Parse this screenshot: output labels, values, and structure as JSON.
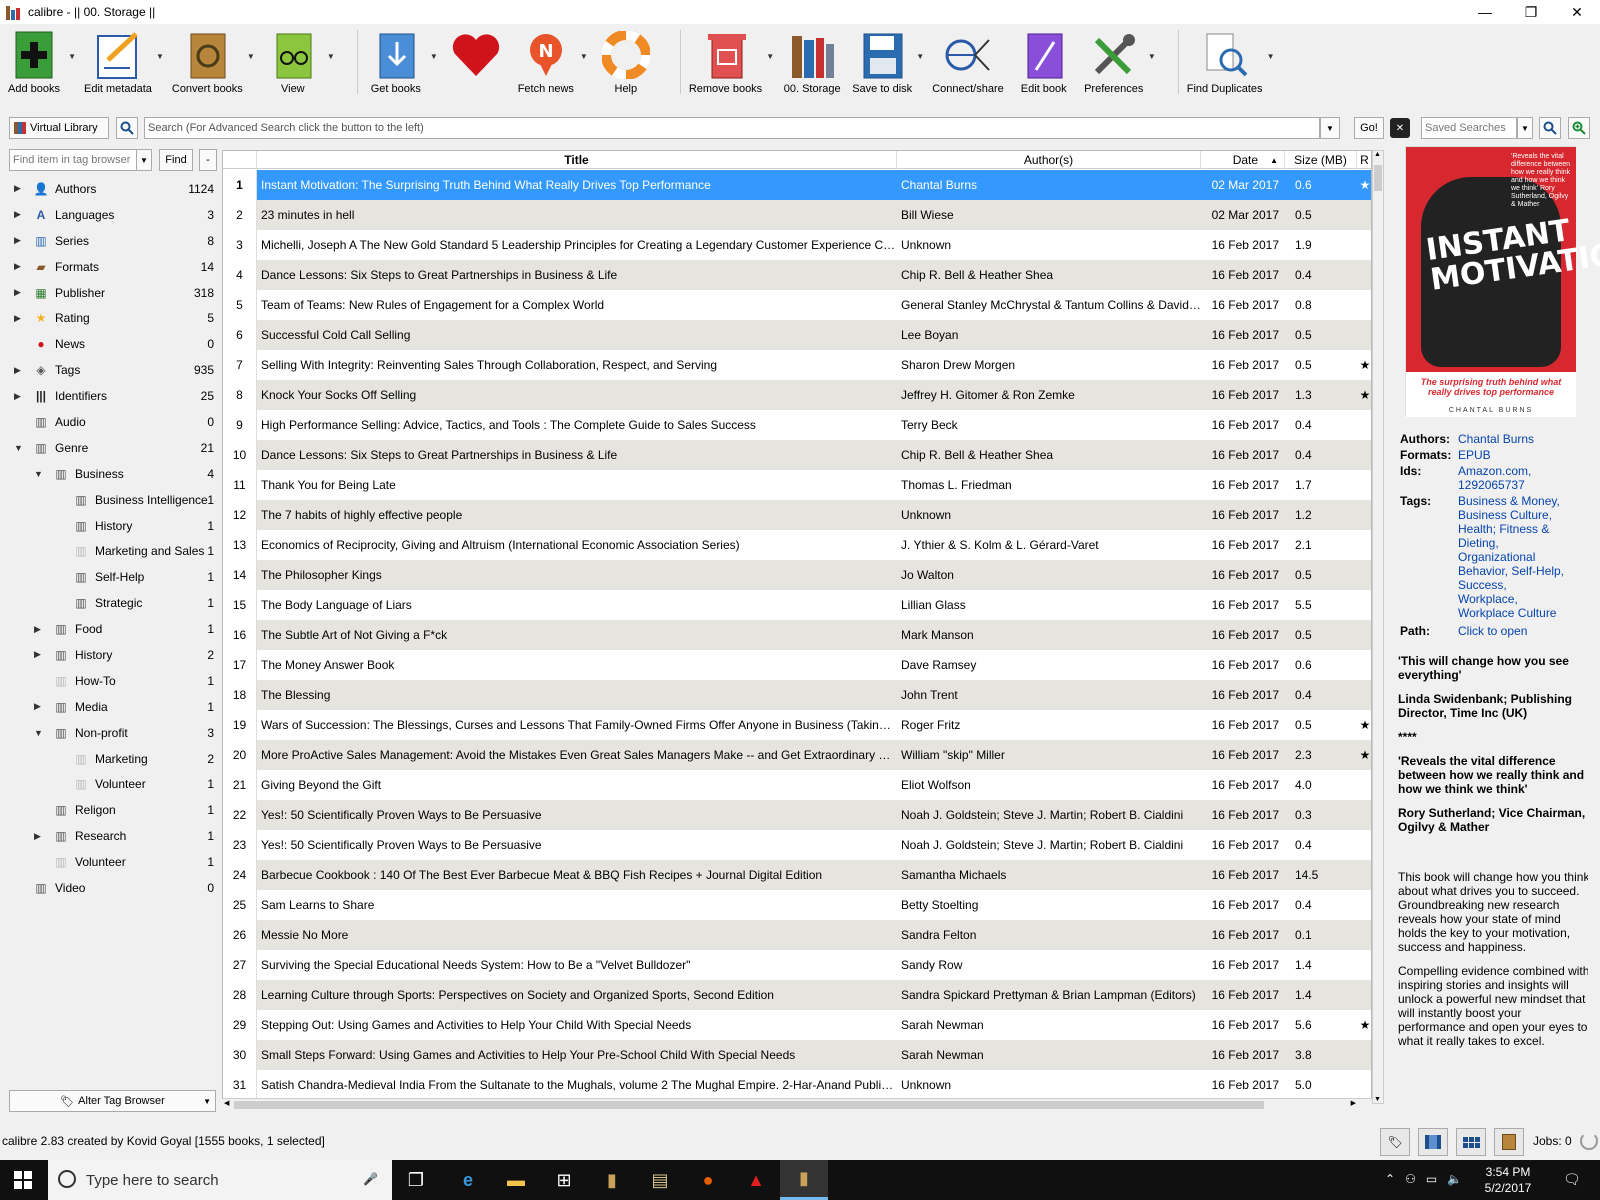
{
  "window": {
    "title": "calibre - || 00. Storage ||",
    "minimize": "—",
    "maximize": "❐",
    "close": "✕"
  },
  "toolbar": [
    {
      "label": "Add books",
      "icon": "add-books-icon",
      "dd": true
    },
    {
      "label": "Edit metadata",
      "icon": "edit-metadata-icon",
      "dd": true
    },
    {
      "label": "Convert books",
      "icon": "convert-books-icon",
      "dd": true
    },
    {
      "label": "View",
      "icon": "view-icon",
      "dd": true
    },
    {
      "label": "Get books",
      "icon": "get-books-icon",
      "dd": true
    },
    {
      "label": "",
      "icon": "heart-icon",
      "dd": false
    },
    {
      "label": "Fetch news",
      "icon": "fetch-news-icon",
      "dd": true
    },
    {
      "label": "Help",
      "icon": "help-icon",
      "dd": false
    },
    {
      "label": "Remove books",
      "icon": "remove-books-icon",
      "dd": true
    },
    {
      "label": "00. Storage",
      "icon": "library-icon",
      "dd": false
    },
    {
      "label": "Save to disk",
      "icon": "save-to-disk-icon",
      "dd": true
    },
    {
      "label": "Connect/share",
      "icon": "connect-share-icon",
      "dd": false
    },
    {
      "label": "Edit book",
      "icon": "edit-book-icon",
      "dd": false
    },
    {
      "label": "Preferences",
      "icon": "preferences-icon",
      "dd": true
    },
    {
      "label": "Find Duplicates",
      "icon": "find-duplicates-icon",
      "dd": true
    }
  ],
  "search": {
    "virtual_library": "Virtual Library",
    "placeholder": "Search (For Advanced Search click the button to the left)",
    "go": "Go!",
    "saved_searches": "Saved Searches"
  },
  "tag_browser": {
    "find_placeholder": "Find item in tag browser",
    "find": "Find",
    "collapse": "-",
    "alter": "Alter Tag Browser",
    "items": [
      {
        "label": "Authors",
        "count": "1124",
        "level": 0,
        "arrow": "▶",
        "icon": "authors-icon"
      },
      {
        "label": "Languages",
        "count": "3",
        "level": 0,
        "arrow": "▶",
        "icon": "languages-icon"
      },
      {
        "label": "Series",
        "count": "8",
        "level": 0,
        "arrow": "▶",
        "icon": "series-icon"
      },
      {
        "label": "Formats",
        "count": "14",
        "level": 0,
        "arrow": "▶",
        "icon": "formats-icon"
      },
      {
        "label": "Publisher",
        "count": "318",
        "level": 0,
        "arrow": "▶",
        "icon": "publisher-icon"
      },
      {
        "label": "Rating",
        "count": "5",
        "level": 0,
        "arrow": "▶",
        "icon": "rating-icon"
      },
      {
        "label": "News",
        "count": "0",
        "level": 0,
        "arrow": "",
        "icon": "news-icon"
      },
      {
        "label": "Tags",
        "count": "935",
        "level": 0,
        "arrow": "▶",
        "icon": "tags-icon"
      },
      {
        "label": "Identifiers",
        "count": "25",
        "level": 0,
        "arrow": "▶",
        "icon": "identifiers-icon"
      },
      {
        "label": "Audio",
        "count": "0",
        "level": 0,
        "arrow": "",
        "icon": "column-icon"
      },
      {
        "label": "Genre",
        "count": "21",
        "level": 0,
        "arrow": "▼",
        "icon": "column-icon"
      },
      {
        "label": "Business",
        "count": "4",
        "level": 1,
        "arrow": "▼",
        "icon": "column-icon"
      },
      {
        "label": "Business Intelligence",
        "count": "1",
        "level": 2,
        "arrow": "",
        "icon": "column-icon"
      },
      {
        "label": "History",
        "count": "1",
        "level": 2,
        "arrow": "",
        "icon": "column-icon"
      },
      {
        "label": "Marketing and Sales",
        "count": "1",
        "level": 2,
        "arrow": "",
        "icon": "column-faded-icon"
      },
      {
        "label": "Self-Help",
        "count": "1",
        "level": 2,
        "arrow": "",
        "icon": "column-icon"
      },
      {
        "label": "Strategic",
        "count": "1",
        "level": 2,
        "arrow": "",
        "icon": "column-icon"
      },
      {
        "label": "Food",
        "count": "1",
        "level": 1,
        "arrow": "▶",
        "icon": "column-icon"
      },
      {
        "label": "History",
        "count": "2",
        "level": 1,
        "arrow": "▶",
        "icon": "column-icon"
      },
      {
        "label": "How-To",
        "count": "1",
        "level": 1,
        "arrow": "",
        "icon": "column-faded-icon"
      },
      {
        "label": "Media",
        "count": "1",
        "level": 1,
        "arrow": "▶",
        "icon": "column-icon"
      },
      {
        "label": "Non-profit",
        "count": "3",
        "level": 1,
        "arrow": "▼",
        "icon": "column-icon"
      },
      {
        "label": "Marketing",
        "count": "2",
        "level": 2,
        "arrow": "",
        "icon": "column-faded-icon"
      },
      {
        "label": "Volunteer",
        "count": "1",
        "level": 2,
        "arrow": "",
        "icon": "column-faded-icon"
      },
      {
        "label": "Religon",
        "count": "1",
        "level": 1,
        "arrow": "",
        "icon": "column-icon"
      },
      {
        "label": "Research",
        "count": "1",
        "level": 1,
        "arrow": "▶",
        "icon": "column-icon"
      },
      {
        "label": "Volunteer",
        "count": "1",
        "level": 1,
        "arrow": "",
        "icon": "column-faded-icon"
      },
      {
        "label": "Video",
        "count": "0",
        "level": 0,
        "arrow": "",
        "icon": "column-icon"
      }
    ]
  },
  "columns": {
    "title": "Title",
    "authors": "Author(s)",
    "date": "Date",
    "size": "Size (MB)",
    "rating": "R"
  },
  "books": [
    {
      "n": "1",
      "title": "Instant Motivation: The Surprising Truth Behind What Really Drives Top Performance",
      "authors": "Chantal Burns",
      "date": "02 Mar 2017",
      "size": "0.6",
      "rating": "★"
    },
    {
      "n": "2",
      "title": "23 minutes in hell",
      "authors": "Bill Wiese",
      "date": "02 Mar 2017",
      "size": "0.5",
      "rating": ""
    },
    {
      "n": "3",
      "title": "Michelli, Joseph A The New Gold Standard 5 Leadership Principles for Creating a Legendary Customer Experience Cour...",
      "authors": "Unknown",
      "date": "16 Feb 2017",
      "size": "1.9",
      "rating": ""
    },
    {
      "n": "4",
      "title": "Dance Lessons: Six Steps to Great Partnerships in Business & Life",
      "authors": "Chip R. Bell & Heather Shea",
      "date": "16 Feb 2017",
      "size": "0.4",
      "rating": ""
    },
    {
      "n": "5",
      "title": "Team of Teams: New Rules of Engagement for a Complex World",
      "authors": "General Stanley McChrystal & Tantum Collins & David ...",
      "date": "16 Feb 2017",
      "size": "0.8",
      "rating": ""
    },
    {
      "n": "6",
      "title": "Successful Cold Call Selling",
      "authors": "Lee Boyan",
      "date": "16 Feb 2017",
      "size": "0.5",
      "rating": ""
    },
    {
      "n": "7",
      "title": "Selling With Integrity: Reinventing Sales Through Collaboration, Respect, and Serving",
      "authors": "Sharon Drew Morgen",
      "date": "16 Feb 2017",
      "size": "0.5",
      "rating": "★"
    },
    {
      "n": "8",
      "title": "Knock Your Socks Off Selling",
      "authors": "Jeffrey H. Gitomer & Ron Zemke",
      "date": "16 Feb 2017",
      "size": "1.3",
      "rating": "★"
    },
    {
      "n": "9",
      "title": "High Performance Selling: Advice, Tactics, and Tools : The Complete Guide to Sales Success",
      "authors": "Terry Beck",
      "date": "16 Feb 2017",
      "size": "0.4",
      "rating": ""
    },
    {
      "n": "10",
      "title": "Dance Lessons: Six Steps to Great Partnerships in Business & Life",
      "authors": "Chip R. Bell & Heather Shea",
      "date": "16 Feb 2017",
      "size": "0.4",
      "rating": ""
    },
    {
      "n": "11",
      "title": "Thank You for Being Late",
      "authors": "Thomas L. Friedman",
      "date": "16 Feb 2017",
      "size": "1.7",
      "rating": ""
    },
    {
      "n": "12",
      "title": "The 7 habits of highly effective people",
      "authors": "Unknown",
      "date": "16 Feb 2017",
      "size": "1.2",
      "rating": ""
    },
    {
      "n": "13",
      "title": "Economics of Reciprocity, Giving and Altruism (International Economic Association Series)",
      "authors": "J. Ythier & S. Kolm & L. Gérard-Varet",
      "date": "16 Feb 2017",
      "size": "2.1",
      "rating": ""
    },
    {
      "n": "14",
      "title": "The Philosopher Kings",
      "authors": "Jo Walton",
      "date": "16 Feb 2017",
      "size": "0.5",
      "rating": ""
    },
    {
      "n": "15",
      "title": "The Body Language of Liars",
      "authors": "Lillian Glass",
      "date": "16 Feb 2017",
      "size": "5.5",
      "rating": ""
    },
    {
      "n": "16",
      "title": "The Subtle Art of Not Giving a F*ck",
      "authors": "Mark Manson",
      "date": "16 Feb 2017",
      "size": "0.5",
      "rating": ""
    },
    {
      "n": "17",
      "title": "The Money Answer Book",
      "authors": "Dave Ramsey",
      "date": "16 Feb 2017",
      "size": "0.6",
      "rating": ""
    },
    {
      "n": "18",
      "title": "The Blessing",
      "authors": "John Trent",
      "date": "16 Feb 2017",
      "size": "0.4",
      "rating": ""
    },
    {
      "n": "19",
      "title": "Wars of Succession: The Blessings, Curses and Lessons That Family-Owned Firms Offer Anyone in Business (Taking Co...",
      "authors": "Roger Fritz",
      "date": "16 Feb 2017",
      "size": "0.5",
      "rating": "★"
    },
    {
      "n": "20",
      "title": "More ProActive Sales Management: Avoid the Mistakes Even Great Sales Managers Make -- and Get Extraordinary Resu...",
      "authors": "William \"skip\" Miller",
      "date": "16 Feb 2017",
      "size": "2.3",
      "rating": "★"
    },
    {
      "n": "21",
      "title": "Giving Beyond the Gift",
      "authors": "Eliot Wolfson",
      "date": "16 Feb 2017",
      "size": "4.0",
      "rating": ""
    },
    {
      "n": "22",
      "title": "Yes!: 50 Scientifically Proven Ways to Be Persuasive",
      "authors": "Noah J. Goldstein; Steve J. Martin; Robert B. Cialdini",
      "date": "16 Feb 2017",
      "size": "0.3",
      "rating": ""
    },
    {
      "n": "23",
      "title": "Yes!: 50 Scientifically Proven Ways to Be Persuasive",
      "authors": "Noah J. Goldstein; Steve J. Martin; Robert B. Cialdini",
      "date": "16 Feb 2017",
      "size": "0.4",
      "rating": ""
    },
    {
      "n": "24",
      "title": "Barbecue Cookbook : 140 Of The Best Ever Barbecue Meat & BBQ Fish Recipes + Journal Digital Edition",
      "authors": "Samantha Michaels",
      "date": "16 Feb 2017",
      "size": "14.5",
      "rating": ""
    },
    {
      "n": "25",
      "title": "Sam Learns to Share",
      "authors": "Betty Stoelting",
      "date": "16 Feb 2017",
      "size": "0.4",
      "rating": ""
    },
    {
      "n": "26",
      "title": "Messie No More",
      "authors": "Sandra Felton",
      "date": "16 Feb 2017",
      "size": "0.1",
      "rating": ""
    },
    {
      "n": "27",
      "title": "Surviving the Special Educational Needs System: How to Be a \"Velvet Bulldozer\"",
      "authors": "Sandy Row",
      "date": "16 Feb 2017",
      "size": "1.4",
      "rating": ""
    },
    {
      "n": "28",
      "title": "Learning Culture through Sports: Perspectives on Society and Organized Sports, Second Edition",
      "authors": "Sandra Spickard Prettyman & Brian Lampman (Editors)",
      "date": "16 Feb 2017",
      "size": "1.4",
      "rating": ""
    },
    {
      "n": "29",
      "title": "Stepping Out: Using Games and Activities to Help Your Child With Special Needs",
      "authors": "Sarah Newman",
      "date": "16 Feb 2017",
      "size": "5.6",
      "rating": "★"
    },
    {
      "n": "30",
      "title": "Small Steps Forward: Using Games and Activities to Help Your Pre-School Child With Special Needs",
      "authors": "Sarah Newman",
      "date": "16 Feb 2017",
      "size": "3.8",
      "rating": ""
    },
    {
      "n": "31",
      "title": "Satish Chandra-Medieval India From the Sultanate to the Mughals, volume 2 The Mughal Empire. 2-Har-Anand Public...",
      "authors": "Unknown",
      "date": "16 Feb 2017",
      "size": "5.0",
      "rating": ""
    }
  ],
  "cover": {
    "blurb": "'Reveals the vital difference between how we really think and how we think we think' Rory Sutherland, Ogilvy & Mather",
    "title": "INSTANT MOTIVATION",
    "subtitle": "The surprising truth behind what really drives top performance",
    "author": "CHANTAL BURNS"
  },
  "details": {
    "authors_k": "Authors:",
    "authors_v": "Chantal Burns",
    "formats_k": "Formats:",
    "formats_v": "EPUB",
    "ids_k": "Ids:",
    "ids_v1": "Amazon.com,",
    "ids_v2": "1292065737",
    "tags_k": "Tags:",
    "tags": [
      "Business & Money,",
      "Business Culture,",
      "Health; Fitness &",
      "Dieting,",
      "Organizational",
      "Behavior, Self-Help,",
      "Success,",
      "Workplace,",
      "Workplace Culture"
    ],
    "path_k": "Path:",
    "path_v": "Click to open",
    "q1": "'This will change how you see everything'",
    "q1a": "Linda Swidenbank; Publishing Director, Time Inc (UK)",
    "stars": "****",
    "q2": "'Reveals the vital difference between how we really think and how we think we think'",
    "q2a": "Rory Sutherland; Vice Chairman, Ogilvy & Mather",
    "p1": "This book will change how you think about what drives you to succeed. Groundbreaking new research  reveals how your state of mind holds the key to your motivation, success and happiness.",
    "p2": "Compelling evidence combined with inspiring stories and insights will unlock a powerful new mindset that will instantly boost your performance and open your eyes to what it really takes to excel."
  },
  "status": {
    "text": "calibre 2.83 created by Kovid Goyal    [1555 books, 1 selected]",
    "jobs": "Jobs: 0"
  },
  "taskbar": {
    "search_placeholder": "Type here to search",
    "time": "3:54 PM",
    "date": "5/2/2017"
  },
  "colors": {
    "selection": "#3399ff",
    "alt_row": "#e6e4df",
    "link": "#0645ad",
    "cover_red": "#d7282f"
  }
}
